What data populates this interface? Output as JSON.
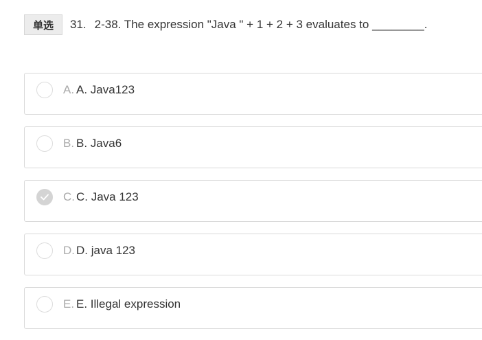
{
  "question": {
    "type_badge": "单选",
    "number": "31.",
    "text": "2-38. The expression \"Java \" + 1 + 2 + 3 evaluates to ________."
  },
  "options": [
    {
      "letter": "A.",
      "text": "A. Java123",
      "selected": false
    },
    {
      "letter": "B.",
      "text": "B. Java6",
      "selected": false
    },
    {
      "letter": "C.",
      "text": "C. Java 123",
      "selected": true
    },
    {
      "letter": "D.",
      "text": "D. java 123",
      "selected": false
    },
    {
      "letter": "E.",
      "text": "E. Illegal expression",
      "selected": false
    }
  ],
  "colors": {
    "border": "#d9d9d9",
    "selected_radio": "#d4d4d4",
    "letter": "#a9a9a9",
    "text": "#333333"
  }
}
